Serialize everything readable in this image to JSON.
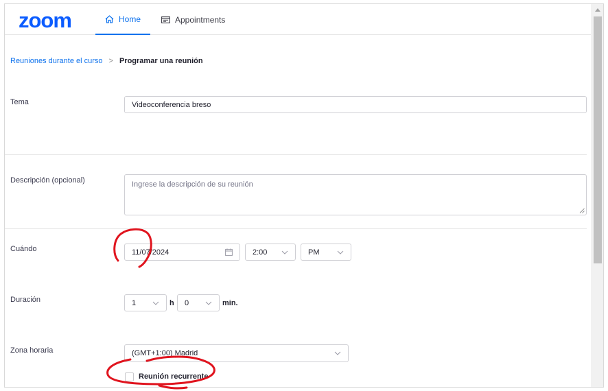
{
  "header": {
    "logo": "zoom",
    "tabs": [
      {
        "label": "Home",
        "icon": "home-icon",
        "active": true
      },
      {
        "label": "Appointments",
        "icon": "calendar-icon",
        "active": false
      }
    ]
  },
  "breadcrumb": {
    "parent": "Reuniones durante el curso",
    "separator": ">",
    "current": "Programar una reunión"
  },
  "form": {
    "topic": {
      "label": "Tema",
      "value": "Videoconferencia breso"
    },
    "description": {
      "label": "Descripción (opcional)",
      "placeholder": "Ingrese la descripción de su reunión"
    },
    "when": {
      "label": "Cuándo",
      "date": "11/07/2024",
      "time": "2:00",
      "ampm": "PM"
    },
    "duration": {
      "label": "Duración",
      "hours": "1",
      "hours_unit": "h",
      "minutes": "0",
      "minutes_unit": "min."
    },
    "timezone": {
      "label": "Zona horaria",
      "value": "(GMT+1:00) Madrid"
    },
    "recurring": {
      "label": "Reunión recurrente",
      "checked": false
    }
  },
  "colors": {
    "accent": "#0e72ed",
    "logo": "#0b5cff",
    "annotation": "#e0141e"
  }
}
